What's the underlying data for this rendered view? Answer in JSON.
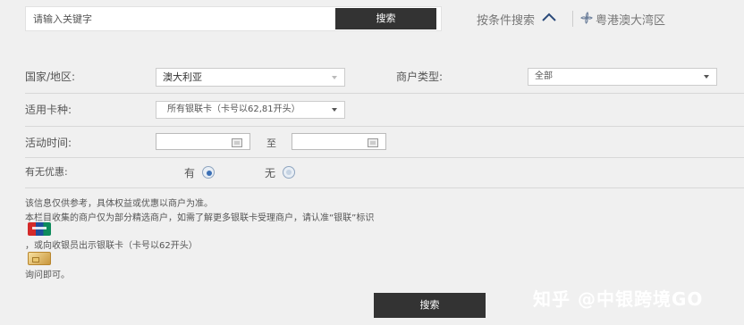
{
  "search": {
    "placeholder": "请输入关键字",
    "button_label": "搜索"
  },
  "header": {
    "condition_search_label": "按条件搜索",
    "region_label": "粤港澳大湾区"
  },
  "form": {
    "country": {
      "label": "国家/地区:",
      "value": "澳大利亚"
    },
    "merchant_type": {
      "label": "商户类型:",
      "value": "全部"
    },
    "card_type": {
      "label": "适用卡种:",
      "value": "所有银联卡（卡号以62,81开头）"
    },
    "activity_time": {
      "label": "活动时间:",
      "separator": "至",
      "start_value": "",
      "end_value": ""
    },
    "discount": {
      "label": "有无优惠:",
      "option_yes": "有",
      "option_no": "无",
      "selected": "有"
    }
  },
  "notes": {
    "line1": "该信息仅供参考，具体权益或优惠以商户为准。",
    "line2": "本栏目收集的商户仅为部分精选商户，如需了解更多银联卡受理商户，请认准“银联”标识",
    "line3": "，或向收银员出示银联卡（卡号以62开头）",
    "line4": "询问即可。"
  },
  "bottom_button_label": "搜索",
  "watermark": "知乎 @中银跨境GO",
  "icons": {
    "chevron": "chevron-up-icon",
    "region": "bauhinia-flower-icon",
    "calendar": "calendar-icon",
    "unionpay": "unionpay-logo-icon",
    "card": "gold-bank-card-icon"
  }
}
